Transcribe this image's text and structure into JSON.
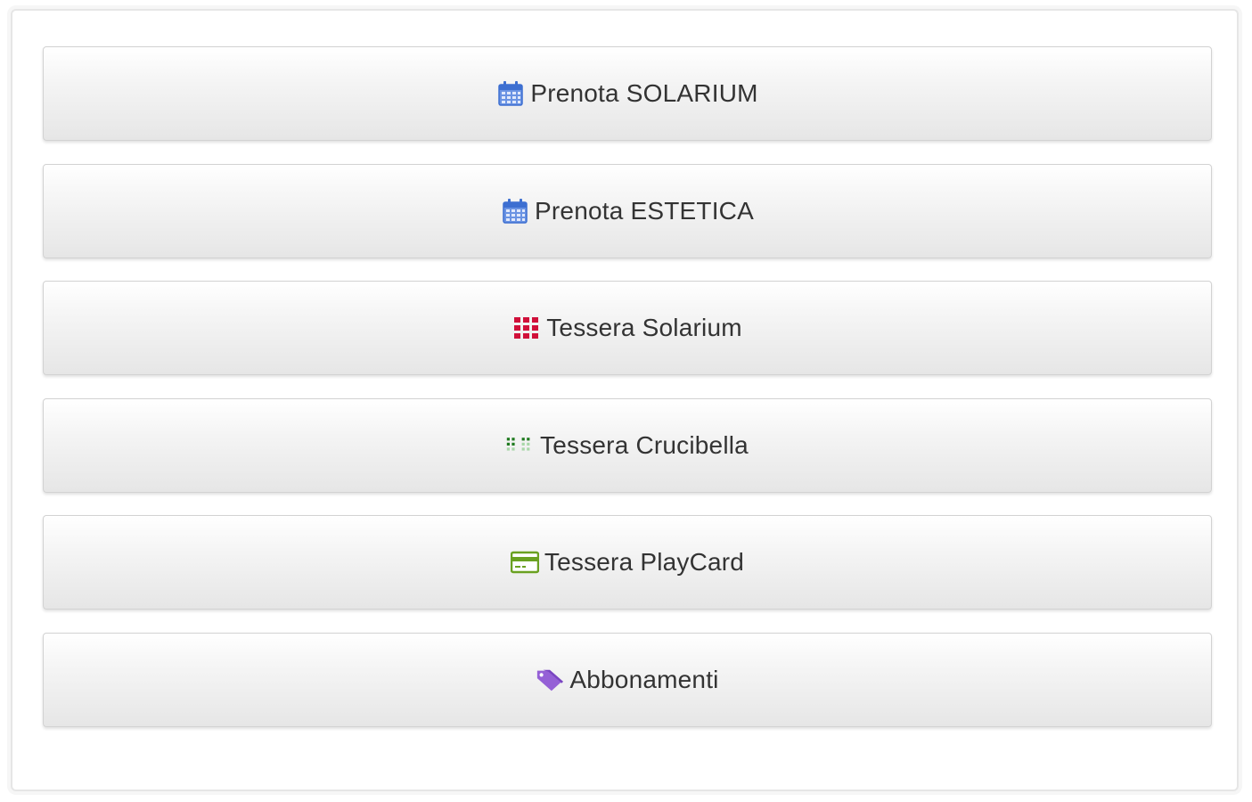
{
  "menu": {
    "items": [
      {
        "label": "Prenota SOLARIUM",
        "icon": "calendar-icon",
        "icon_color": "#3d6fd1"
      },
      {
        "label": "Prenota ESTETICA",
        "icon": "calendar-icon",
        "icon_color": "#3d6fd1"
      },
      {
        "label": "Tessera Solarium",
        "icon": "grid-icon",
        "icon_color": "#d0103a"
      },
      {
        "label": "Tessera Crucibella",
        "icon": "grid-icon",
        "icon_color": "#2d8a2d"
      },
      {
        "label": "Tessera PlayCard",
        "icon": "credit-card-icon",
        "icon_color": "#6aa121"
      },
      {
        "label": "Abbonamenti",
        "icon": "tags-icon",
        "icon_color": "#9560d6"
      }
    ]
  },
  "colors": {
    "text": "#333333",
    "button_border": "#d2d2d2",
    "panel_border": "#e6e6e6"
  }
}
